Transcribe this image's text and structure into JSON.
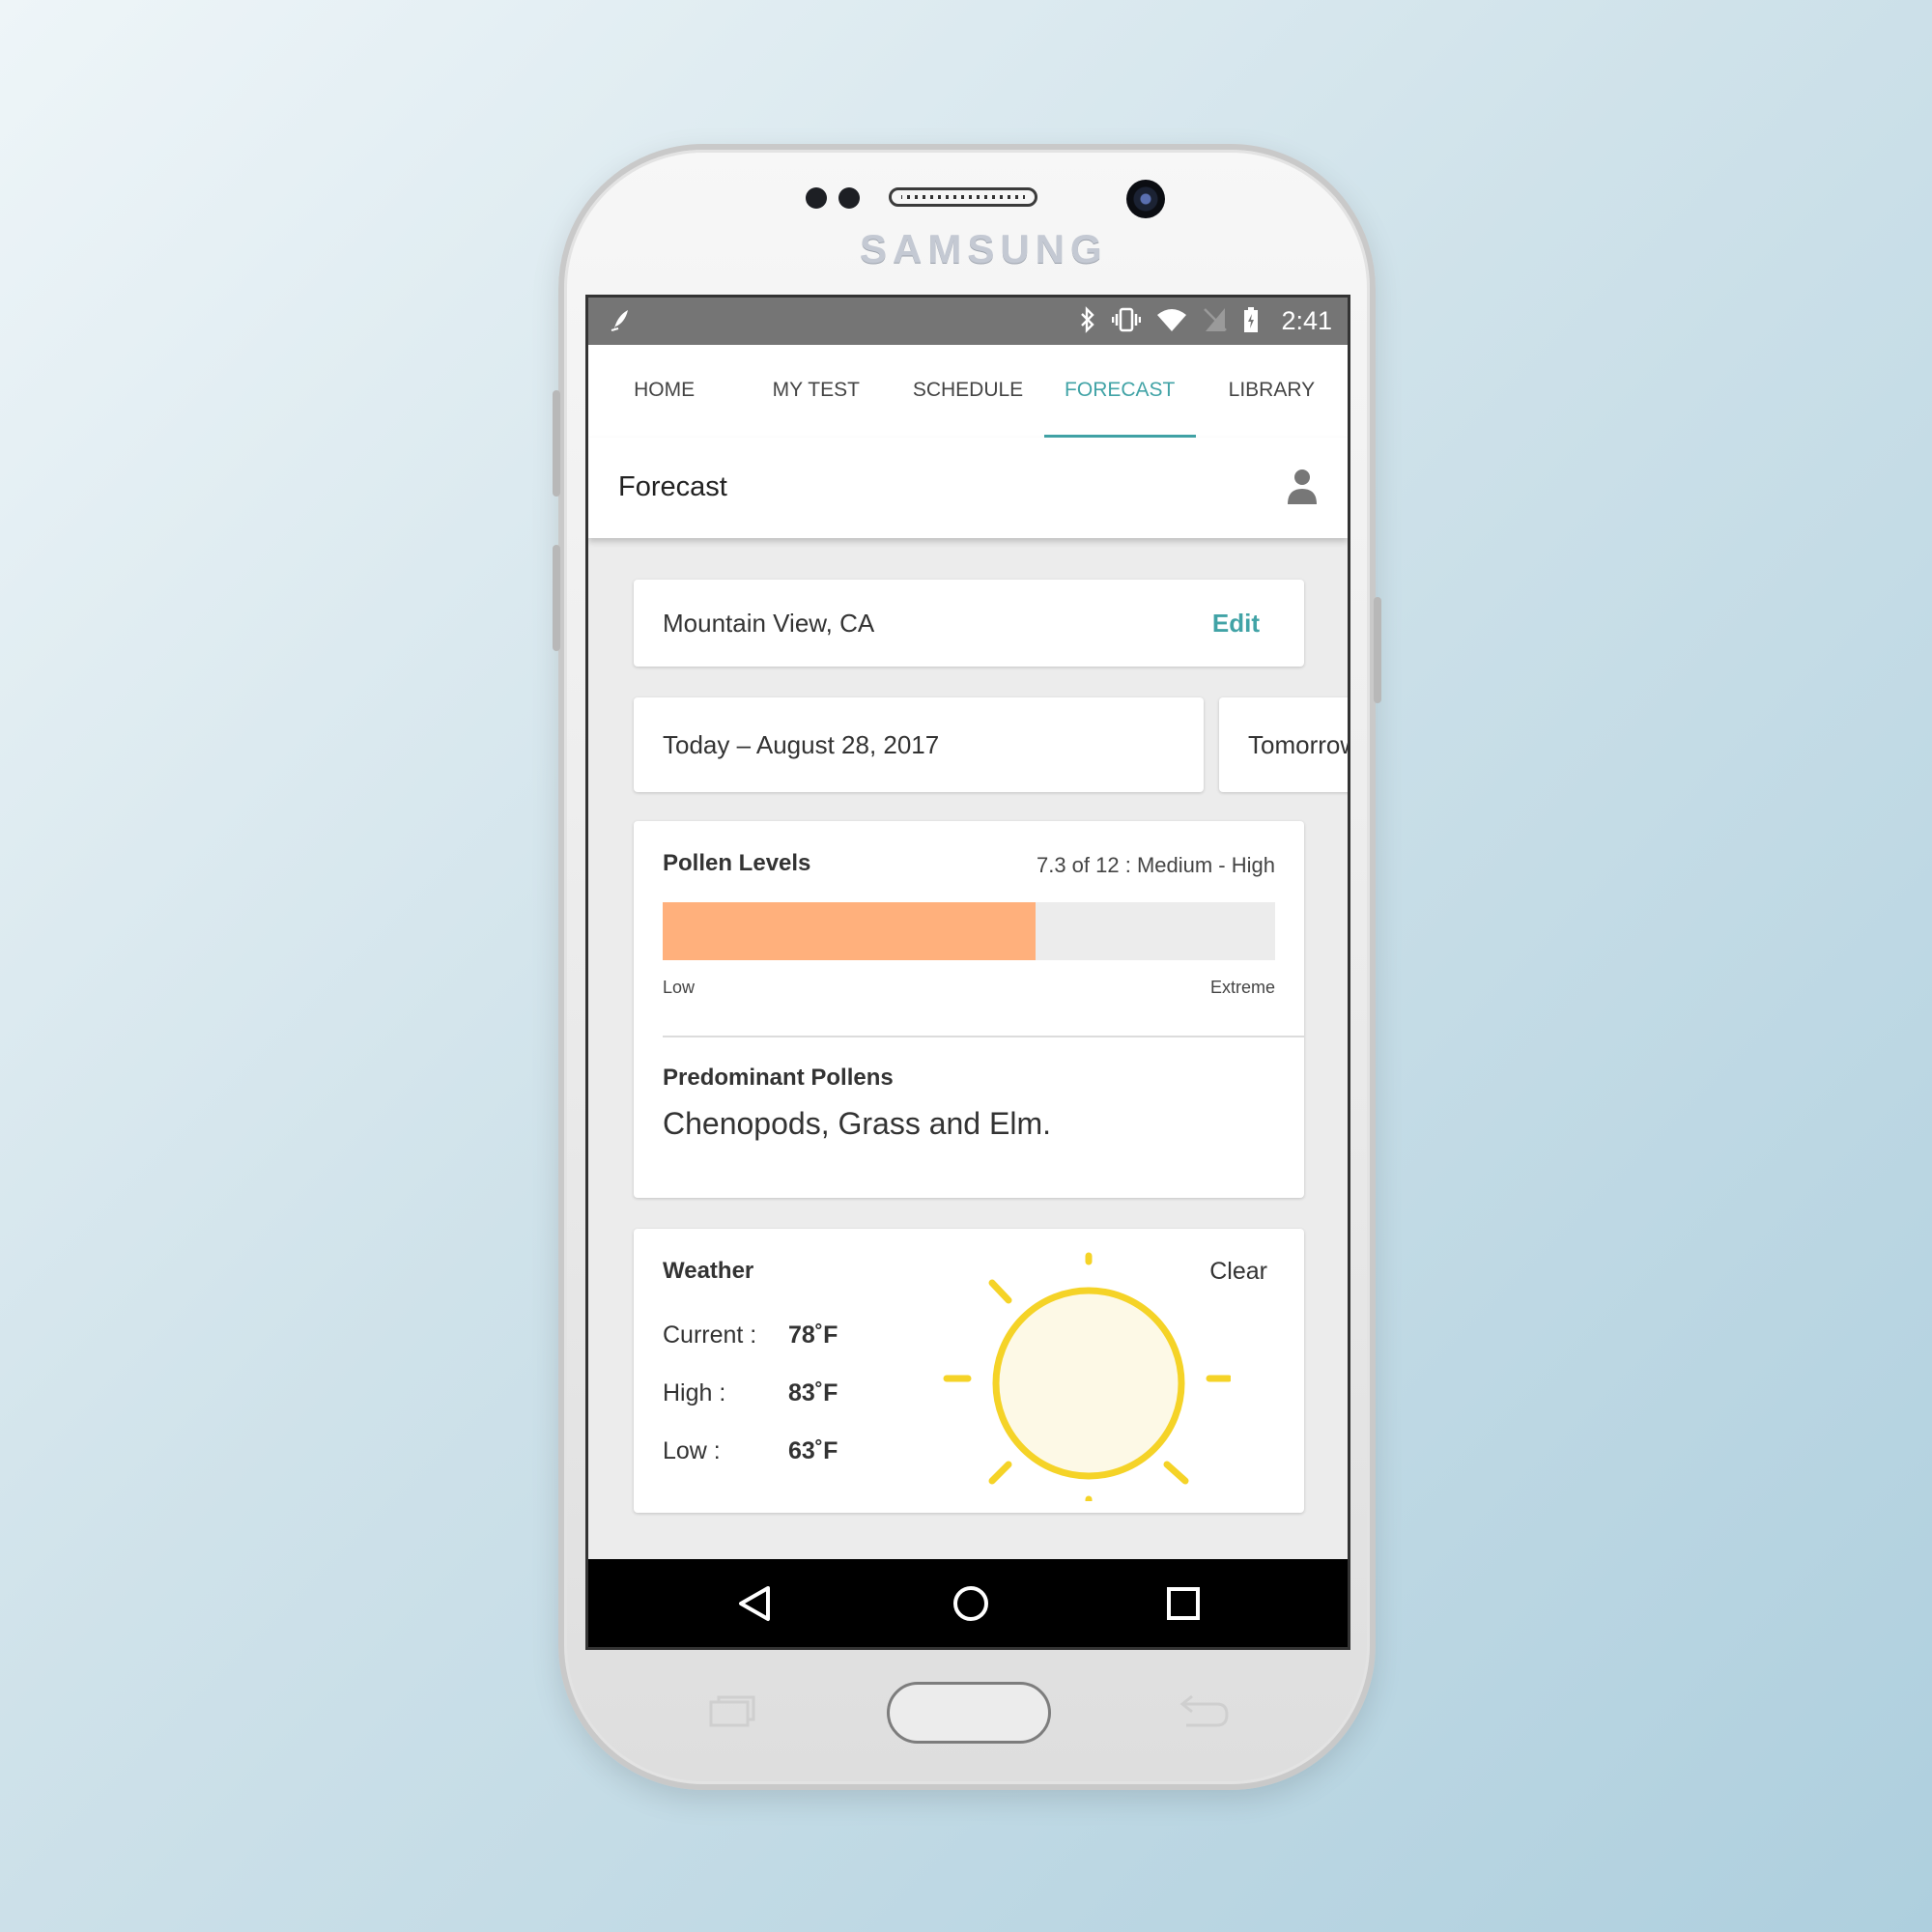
{
  "device": {
    "brand": "SAMSUNG"
  },
  "status_bar": {
    "left_icon": "leaf-icon",
    "icons": [
      "bluetooth-icon",
      "vibrate-icon",
      "wifi-icon",
      "no-sim-icon",
      "battery-charging-icon"
    ],
    "time": "2:41"
  },
  "tabs": [
    {
      "label": "HOME",
      "active": false
    },
    {
      "label": "MY TEST",
      "active": false
    },
    {
      "label": "SCHEDULE",
      "active": false
    },
    {
      "label": "FORECAST",
      "active": true
    },
    {
      "label": "LIBRARY",
      "active": false
    }
  ],
  "appbar": {
    "title": "Forecast",
    "profile_icon": "person-icon"
  },
  "location": {
    "name": "Mountain View, CA",
    "edit_label": "Edit"
  },
  "days": [
    {
      "label": "Today – August 28, 2017"
    },
    {
      "label": "Tomorrow"
    }
  ],
  "pollen": {
    "title": "Pollen Levels",
    "summary": "7.3 of 12 : Medium - High",
    "value": 7.3,
    "max": 12,
    "low_label": "Low",
    "high_label": "Extreme",
    "bar_color": "#ffb07c",
    "predominant_title": "Predominant Pollens",
    "predominant_text": "Chenopods, Grass and Elm."
  },
  "weather": {
    "title": "Weather",
    "condition": "Clear",
    "condition_icon": "sun-icon",
    "rows": [
      {
        "label": "Current :",
        "value": "78˚F"
      },
      {
        "label": "High :",
        "value": "83˚F"
      },
      {
        "label": "Low :",
        "value": "63˚F"
      }
    ]
  },
  "colors": {
    "accent": "#41a3a6",
    "sun": "#f5d327"
  }
}
